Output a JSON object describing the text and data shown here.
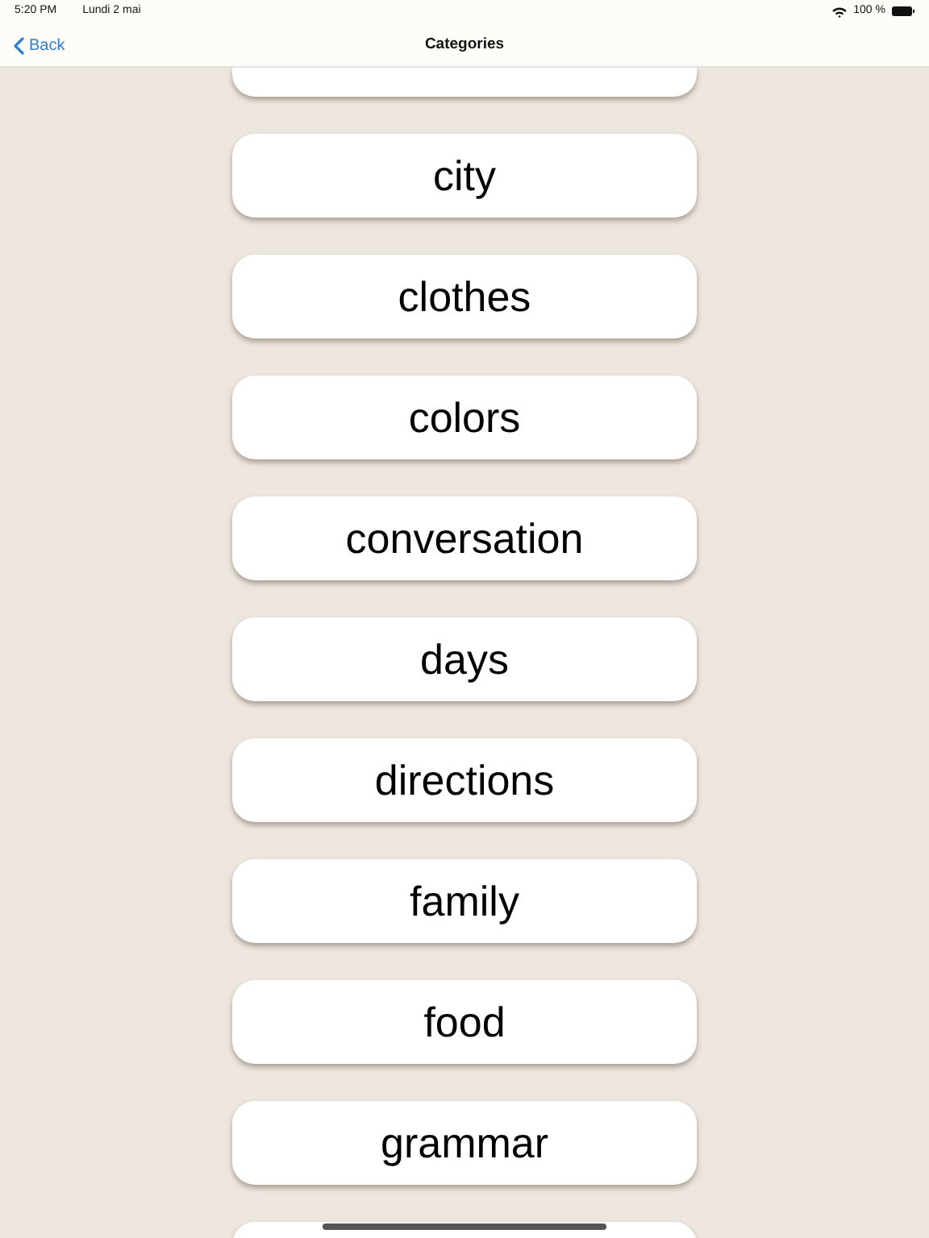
{
  "status_bar": {
    "time": "5:20 PM",
    "date": "Lundi 2 mai",
    "battery": "100 %"
  },
  "nav": {
    "back": "Back",
    "title": "Categories"
  },
  "more_above": true,
  "categories": [
    {
      "label": "city"
    },
    {
      "label": "clothes"
    },
    {
      "label": "colors"
    },
    {
      "label": "conversation"
    },
    {
      "label": "days"
    },
    {
      "label": "directions"
    },
    {
      "label": "family"
    },
    {
      "label": "food"
    },
    {
      "label": "grammar"
    }
  ],
  "more_below": true
}
